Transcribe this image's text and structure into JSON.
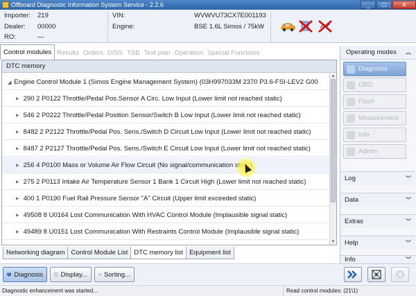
{
  "window": {
    "title": "Offboard Diagnostic Information System Service - 2.2.6",
    "minimize": "_",
    "maximize": "□",
    "close": "✕"
  },
  "header": {
    "importer_label": "Importer:",
    "importer_value": "219",
    "dealer_label": "Dealer:",
    "dealer_value": "00000",
    "ro_label": "RO:",
    "ro_value": "—",
    "vin_label": "VIN:",
    "vin_value": "WVWVU73CX7E001193",
    "engine_label": "Engine:",
    "engine_value": "BSE 1.6L Simos / 75kW"
  },
  "tabs_top": [
    "Control modules",
    "Results",
    "Orders",
    "DISS",
    "TSB",
    "Test plan",
    "Operation",
    "Special Functions"
  ],
  "dtc": {
    "header": "DTC memory",
    "ecu_row": "Engine Control Module 1 (Simos Engine Management System) (03H997033M    2370    P3.6-FSI-LEV2   G00",
    "rows": [
      "290  2  P0122  Throttle/Pedal Pos.Sensor A Circ. Low Input  (Lower limit not reached   static)",
      "546  2  P0222  Throttle/Pedal Position Sensor/Switch B Low Input  (Lower limit not reached   static)",
      "8482  2  P2122  Throttle/Pedal Pos. Sens./Switch D Circuit Low Input  (Lower limit not reached   static)",
      "8487  2  P2127  Throttle/Pedal Pos. Sens./Switch E Circuit Low Input  (Lower limit not reached   static)",
      "256  4  P0100  Mass or Volume Air Flow Circuit  (No signal/communication   static)",
      "275  2  P0113  Intake Air Temperature Sensor 1 Bank 1 Circuit High  (Lower limit not reached   static)",
      "400  1  P0190  Fuel Rail Pressure Sensor \"A\" Circuit  (Upper limit exceeded   static)",
      "49508  8  U0164  Lost Communication With HVAC Control Module  (Implausible signal   static)",
      "49489  8  U0151  Lost Communication With Restraints Control Module  (Implausible signal   static)"
    ]
  },
  "tabs_bottom": [
    "Networking diagram",
    "Control Module List",
    "DTC memory list",
    "Equipment list"
  ],
  "buttons": {
    "diagnosis": "Diagnosis",
    "display": "Display...",
    "sorting": "Sorting..."
  },
  "status": {
    "left": "Diagnostic enhancement was started...",
    "right": "Read control modules: (21\\1)"
  },
  "right_panel": {
    "header": "Operating modes",
    "modes": [
      "Diagnosis",
      "OBD",
      "Flash",
      "Measurement",
      "Info",
      "Admin"
    ],
    "sections": [
      "Log",
      "Data",
      "Extras",
      "Help",
      "Info"
    ]
  },
  "colors": {
    "accent": "#2e64a8",
    "red_cross": "#d01010",
    "car": "#f0a020"
  }
}
